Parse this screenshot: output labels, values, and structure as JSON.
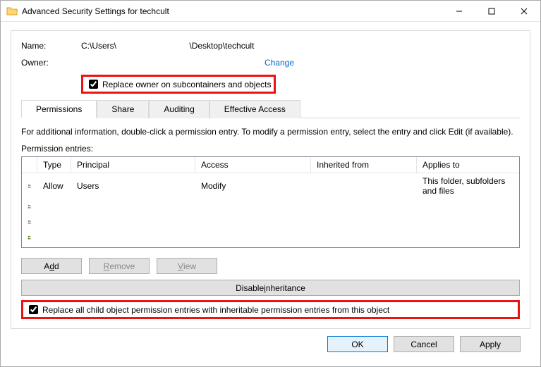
{
  "titlebar": {
    "title": "Advanced Security Settings for techcult"
  },
  "top": {
    "name_label": "Name:",
    "name_value": "C:\\Users\\                               \\Desktop\\techcult",
    "owner_label": "Owner:",
    "change_link": "Change",
    "replace_owner_label": "Replace owner on subcontainers and objects"
  },
  "tabs": {
    "permissions": "Permissions",
    "share": "Share",
    "auditing": "Auditing",
    "effective": "Effective Access"
  },
  "info": "For additional information, double-click a permission entry. To modify a permission entry, select the entry and click Edit (if available).",
  "entries_label": "Permission entries:",
  "columns": {
    "type": "Type",
    "principal": "Principal",
    "access": "Access",
    "inherited": "Inherited from",
    "applies": "Applies to"
  },
  "rows": [
    {
      "type": "Allow",
      "principal": "Users",
      "access": "Modify",
      "inherited": "",
      "applies": "This folder, subfolders and files"
    },
    {
      "type": "",
      "principal": "",
      "access": "",
      "inherited": "",
      "applies": ""
    },
    {
      "type": "",
      "principal": "",
      "access": "",
      "inherited": "",
      "applies": ""
    },
    {
      "type": "",
      "principal": "",
      "access": "",
      "inherited": "",
      "applies": ""
    }
  ],
  "buttons": {
    "add_pre": "A",
    "add_u": "d",
    "add_post": "d",
    "remove_pre": "",
    "remove_u": "R",
    "remove_post": "emove",
    "view_pre": "",
    "view_u": "V",
    "view_post": "iew",
    "disable_pre": "Disable ",
    "disable_u": "i",
    "disable_post": "nheritance"
  },
  "replace_child": "Replace all child object permission entries with inheritable permission entries from this object",
  "footer": {
    "ok": "OK",
    "cancel": "Cancel",
    "apply": "Apply"
  }
}
